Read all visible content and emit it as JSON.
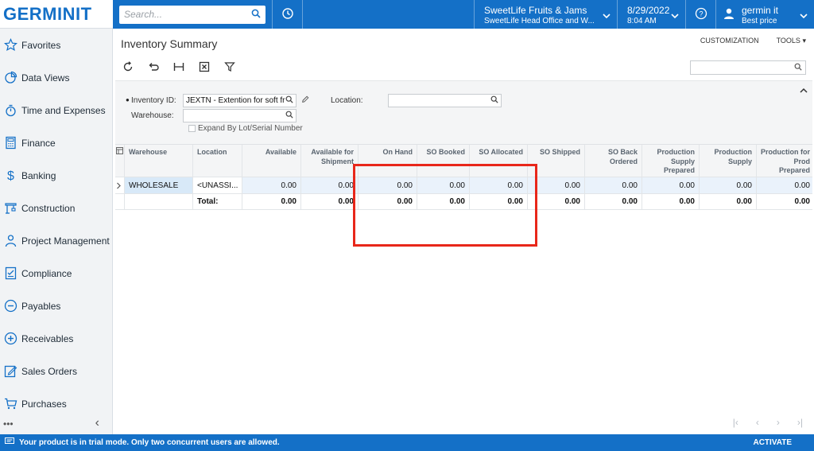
{
  "logo": {
    "text": "GERMINIT"
  },
  "search": {
    "placeholder": "Search..."
  },
  "company": {
    "name": "SweetLife Fruits & Jams",
    "branch": "SweetLife Head Office and W..."
  },
  "datetime": {
    "date": "8/29/2022",
    "time": "8:04 AM"
  },
  "user": {
    "name": "germin it",
    "subtitle": "Best price"
  },
  "sidebar": {
    "items": [
      {
        "label": "Favorites",
        "icon": "star-icon"
      },
      {
        "label": "Data Views",
        "icon": "pie-chart-icon"
      },
      {
        "label": "Time and Expenses",
        "icon": "stopwatch-icon"
      },
      {
        "label": "Finance",
        "icon": "calculator-icon"
      },
      {
        "label": "Banking",
        "icon": "dollar-icon"
      },
      {
        "label": "Construction",
        "icon": "construction-icon"
      },
      {
        "label": "Project Management",
        "icon": "person-icon"
      },
      {
        "label": "Compliance",
        "icon": "checklist-icon"
      },
      {
        "label": "Payables",
        "icon": "minus-circle-icon"
      },
      {
        "label": "Receivables",
        "icon": "plus-circle-icon"
      },
      {
        "label": "Sales Orders",
        "icon": "edit-icon"
      },
      {
        "label": "Purchases",
        "icon": "cart-icon"
      }
    ],
    "more": "•••",
    "collapse": "‹"
  },
  "page": {
    "title": "Inventory Summary",
    "customization": "CUSTOMIZATION",
    "tools": "TOOLS"
  },
  "form": {
    "inventory_label": "Inventory ID:",
    "inventory_value": "JEXTN - Extention for soft fru",
    "warehouse_label": "Warehouse:",
    "warehouse_value": "",
    "location_label": "Location:",
    "location_value": "",
    "expand_label": "Expand By Lot/Serial Number"
  },
  "grid": {
    "columns": [
      "Warehouse",
      "Location",
      "Available",
      "Available for Shipment",
      "On Hand",
      "SO Booked",
      "SO Allocated",
      "SO Shipped",
      "SO Back Ordered",
      "Production Supply Prepared",
      "Production Supply",
      "Production for Prod Prepared"
    ],
    "row": {
      "warehouse": "WHOLESALE",
      "location": "<UNASSI...",
      "values": [
        "0.00",
        "0.00",
        "0.00",
        "0.00",
        "0.00",
        "0.00",
        "0.00",
        "0.00",
        "0.00",
        "0.00"
      ]
    },
    "total": {
      "label": "Total:",
      "values": [
        "0.00",
        "0.00",
        "0.00",
        "0.00",
        "0.00",
        "0.00",
        "0.00",
        "0.00",
        "0.00",
        "0.00"
      ]
    }
  },
  "footer": {
    "message": "Your product is in trial mode. Only two concurrent users are allowed.",
    "activate": "ACTIVATE"
  },
  "colors": {
    "brand": "#1470c7",
    "highlight": "#e8271a",
    "selected_row": "#eaf2fb"
  }
}
